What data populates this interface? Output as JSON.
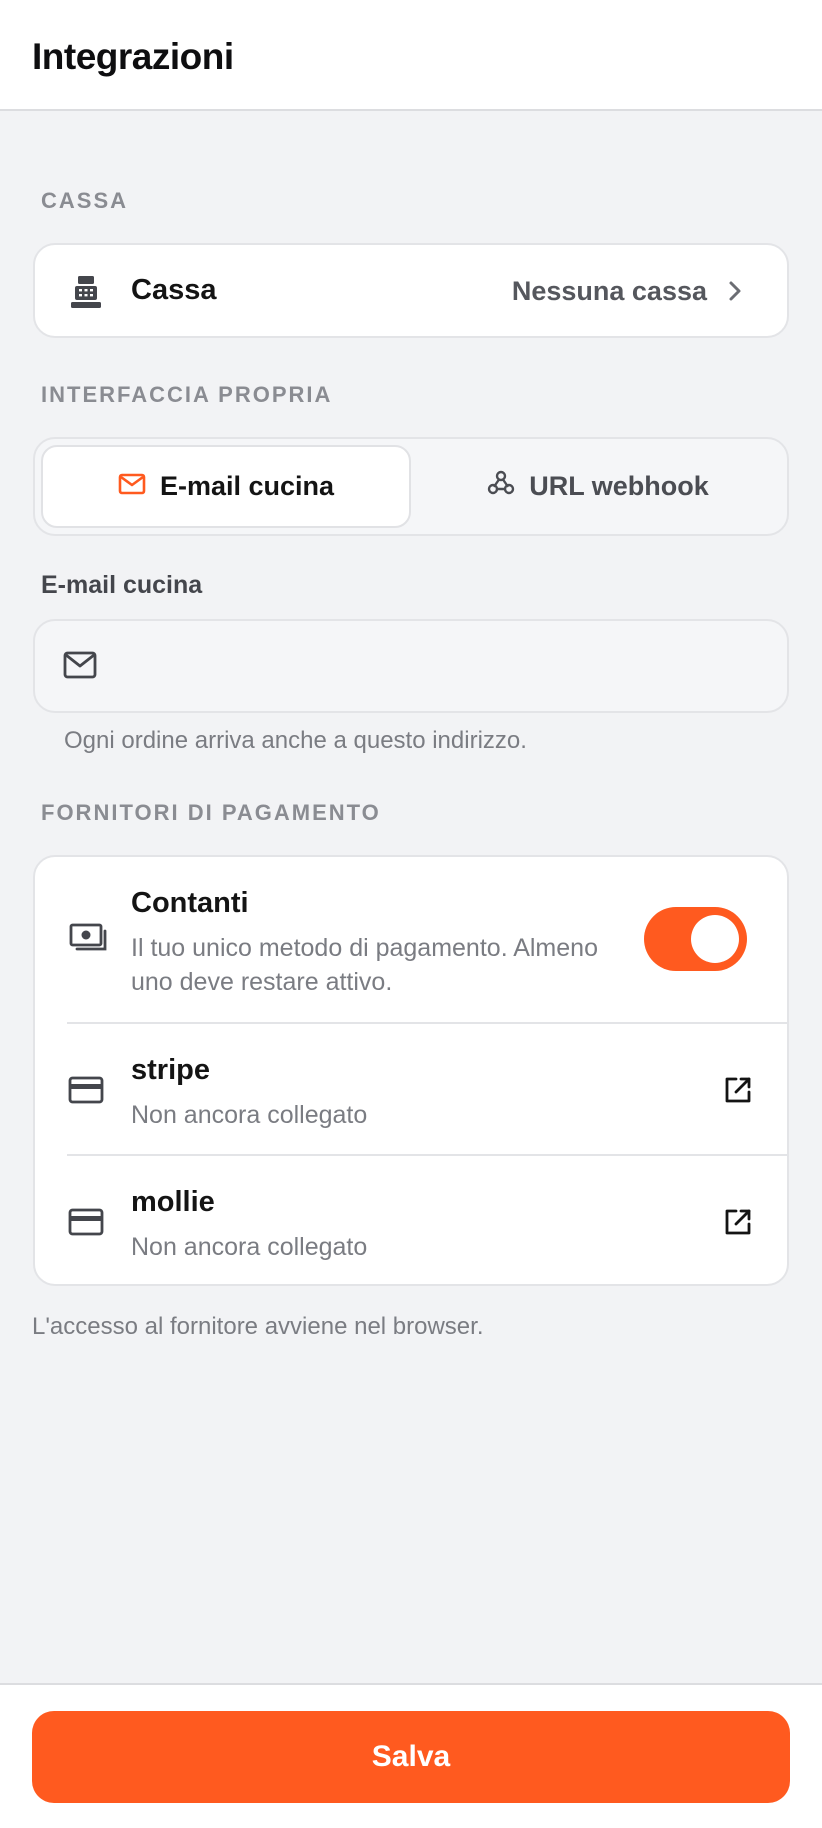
{
  "header": {
    "title": "Integrazioni"
  },
  "cassa": {
    "section_label": "CASSA",
    "title": "Cassa",
    "value": "Nessuna cassa"
  },
  "interface": {
    "section_label": "INTERFACCIA PROPRIA",
    "tabs": [
      {
        "label": "E-mail cucina",
        "icon": "mail-icon",
        "active": true
      },
      {
        "label": "URL webhook",
        "icon": "webhook-icon",
        "active": false
      }
    ],
    "field_label": "E-mail cucina",
    "email_value": "",
    "hint": "Ogni ordine arriva anche a questo indirizzo."
  },
  "payments": {
    "section_label": "FORNITORI DI PAGAMENTO",
    "providers": [
      {
        "name": "Contanti",
        "sub_line1": "Il tuo unico metodo di pagamento. Almeno",
        "sub_line2": "uno deve restare attivo.",
        "icon": "cash-icon",
        "enabled": true
      },
      {
        "name": "stripe",
        "sub": "Non ancora collegato",
        "icon": "credit-card-icon"
      },
      {
        "name": "mollie",
        "sub": "Non ancora collegato",
        "icon": "credit-card-icon"
      }
    ],
    "footnote": "L'accesso al fornitore avviene nel browser."
  },
  "actions": {
    "save_label": "Salva"
  },
  "colors": {
    "accent": "#ff5a1f",
    "background": "#f2f3f5",
    "card": "#ffffff"
  }
}
